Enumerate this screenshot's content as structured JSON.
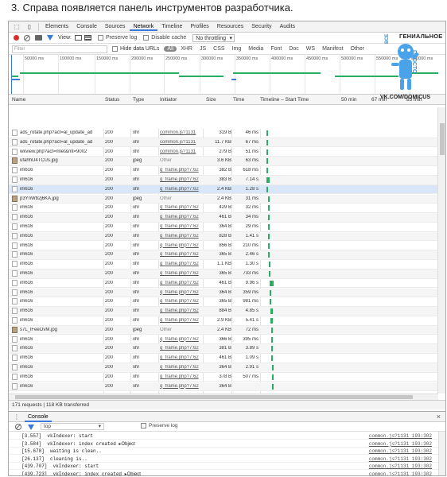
{
  "caption": "3. Справа появляется панель инструментов разработчика.",
  "devtools": {
    "tabs": [
      "Elements",
      "Console",
      "Sources",
      "Network",
      "Timeline",
      "Profiles",
      "Resources",
      "Security",
      "Audits"
    ],
    "active_tab": "Network"
  },
  "network_toolbar": {
    "view_label": "View:",
    "preserve_log": "Preserve log",
    "disable_cache": "Disable cache",
    "throttling": "No throttling"
  },
  "filter_bar": {
    "placeholder": "Filter",
    "hide_data_urls": "Hide data URLs",
    "types": [
      "All",
      "XHR",
      "JS",
      "CSS",
      "Img",
      "Media",
      "Font",
      "Doc",
      "WS",
      "Manifest",
      "Other"
    ]
  },
  "overview": {
    "ticks": [
      "50000 ms",
      "100000 ms",
      "150000 ms",
      "200000 ms",
      "250000 ms",
      "300000 ms",
      "350000 ms",
      "400000 ms",
      "450000 ms",
      "500000 ms",
      "550000 ms",
      "600000 ms"
    ]
  },
  "grid": {
    "columns": [
      "Name",
      "Status",
      "Type",
      "Initiator",
      "Size",
      "Time",
      "Timeline – Start Time",
      "50 min",
      "67 min",
      "83 min"
    ],
    "rows": [
      {
        "name": "ads_rotate.php?act=al_update_ad",
        "status": "200",
        "type": "xhr",
        "initiator": "common.js?1131",
        "size": "319 B",
        "time": "46 ms",
        "icon": "doc"
      },
      {
        "name": "ads_rotate.php?act=al_update_ad",
        "status": "200",
        "type": "xhr",
        "initiator": "common.js?1131",
        "size": "11.7 KB",
        "time": "67 ms",
        "icon": "doc"
      },
      {
        "name": "wkview.php?act=mlet&mt=9002",
        "status": "200",
        "type": "xhr",
        "initiator": "common.js?1131",
        "size": "279 B",
        "time": "51 ms",
        "icon": "doc"
      },
      {
        "name": "ufahhU4TCUs.jpg",
        "status": "200",
        "type": "jpeg",
        "initiator": "Other",
        "size": "3.6 KB",
        "time": "63 ms",
        "icon": "img"
      },
      {
        "name": "im616",
        "status": "200",
        "type": "xhr",
        "initiator": "q_frame.php?7:62",
        "size": "382 B",
        "time": "618 ms",
        "icon": "doc"
      },
      {
        "name": "im616",
        "status": "200",
        "type": "xhr",
        "initiator": "q_frame.php?7:62",
        "size": "383 B",
        "time": "7.14 s",
        "icon": "doc"
      },
      {
        "name": "im616",
        "status": "200",
        "type": "xhr",
        "initiator": "q_frame.php?7:62",
        "size": "2.4 KB",
        "time": "1.28 s",
        "icon": "doc"
      },
      {
        "name": "p3YnWb2j6KA.jpg",
        "status": "200",
        "type": "jpeg",
        "initiator": "Other",
        "size": "2.4 KB",
        "time": "31 ms",
        "icon": "img"
      },
      {
        "name": "im616",
        "status": "200",
        "type": "xhr",
        "initiator": "q_frame.php?7:62",
        "size": "429 B",
        "time": "32 ms",
        "icon": "doc"
      },
      {
        "name": "im616",
        "status": "200",
        "type": "xhr",
        "initiator": "q_frame.php?7:62",
        "size": "461 B",
        "time": "34 ms",
        "icon": "doc"
      },
      {
        "name": "im616",
        "status": "200",
        "type": "xhr",
        "initiator": "q_frame.php?7:62",
        "size": "364 B",
        "time": "29 ms",
        "icon": "doc"
      },
      {
        "name": "im616",
        "status": "200",
        "type": "xhr",
        "initiator": "q_frame.php?7:62",
        "size": "828 B",
        "time": "1.41 s",
        "icon": "doc"
      },
      {
        "name": "im616",
        "status": "200",
        "type": "xhr",
        "initiator": "q_frame.php?7:62",
        "size": "856 B",
        "time": "210 ms",
        "icon": "doc"
      },
      {
        "name": "im616",
        "status": "200",
        "type": "xhr",
        "initiator": "q_frame.php?7:62",
        "size": "365 B",
        "time": "2.46 s",
        "icon": "doc"
      },
      {
        "name": "im616",
        "status": "200",
        "type": "xhr",
        "initiator": "q_frame.php?7:62",
        "size": "1.1 KB",
        "time": "1.30 s",
        "icon": "doc"
      },
      {
        "name": "im616",
        "status": "200",
        "type": "xhr",
        "initiator": "q_frame.php?7:62",
        "size": "365 B",
        "time": "733 ms",
        "icon": "doc"
      },
      {
        "name": "im616",
        "status": "200",
        "type": "xhr",
        "initiator": "q_frame.php?7:62",
        "size": "461 B",
        "time": "9.96 s",
        "icon": "doc"
      },
      {
        "name": "im616",
        "status": "200",
        "type": "xhr",
        "initiator": "q_frame.php?7:62",
        "size": "364 B",
        "time": "359 ms",
        "icon": "doc"
      },
      {
        "name": "im616",
        "status": "200",
        "type": "xhr",
        "initiator": "q_frame.php?7:62",
        "size": "365 B",
        "time": "981 ms",
        "icon": "doc"
      },
      {
        "name": "im616",
        "status": "200",
        "type": "xhr",
        "initiator": "q_frame.php?7:62",
        "size": "884 B",
        "time": "4.85 s",
        "icon": "doc"
      },
      {
        "name": "im616",
        "status": "200",
        "type": "xhr",
        "initiator": "q_frame.php?7:62",
        "size": "2.9 KB",
        "time": "5.41 s",
        "icon": "doc"
      },
      {
        "name": "s7L_lFeeOvM.jpg",
        "status": "200",
        "type": "jpeg",
        "initiator": "Other",
        "size": "2.4 KB",
        "time": "72 ms",
        "icon": "img"
      },
      {
        "name": "im616",
        "status": "200",
        "type": "xhr",
        "initiator": "q_frame.php?7:62",
        "size": "366 B",
        "time": "395 ms",
        "icon": "doc"
      },
      {
        "name": "im616",
        "status": "200",
        "type": "xhr",
        "initiator": "q_frame.php?7:62",
        "size": "381 B",
        "time": "3.89 s",
        "icon": "doc"
      },
      {
        "name": "im616",
        "status": "200",
        "type": "xhr",
        "initiator": "q_frame.php?7:62",
        "size": "461 B",
        "time": "1.09 s",
        "icon": "doc"
      },
      {
        "name": "im616",
        "status": "200",
        "type": "xhr",
        "initiator": "q_frame.php?7:62",
        "size": "364 B",
        "time": "2.91 s",
        "icon": "doc"
      },
      {
        "name": "im616",
        "status": "200",
        "type": "xhr",
        "initiator": "q_frame.php?7:62",
        "size": "378 B",
        "time": "507 ms",
        "icon": "doc"
      },
      {
        "name": "im616",
        "status": "200",
        "type": "xhr",
        "initiator": "q_frame.php?7:62",
        "size": "364 B",
        "time": "",
        "icon": "doc"
      }
    ]
  },
  "summary": "171 requests  |  118 KB transferred",
  "console": {
    "tab": "Console",
    "context": "top",
    "preserve_log": "Preserve log",
    "lines": [
      {
        "text": "[3.557]  vkIndexer: start",
        "object": "",
        "source": "common.js?1131 193:302"
      },
      {
        "text": "[3.584]  vkIndexer: index created ",
        "object": "▸Object",
        "source": "common.js?1131 193:302"
      },
      {
        "text": "[15.678]  waiting is clean..",
        "object": "",
        "source": "common.js?1131 193:302"
      },
      {
        "text": "[26.137]  cleaning is..",
        "object": "",
        "source": "common.js?1131 193:302"
      },
      {
        "text": "[439.707]  vkIndexer: start",
        "object": "",
        "source": "common.js?1131 193:302"
      },
      {
        "text": "[439.723]  vkIndexer: index created ",
        "object": "▸Object",
        "source": "common.js?1131 193:302"
      }
    ]
  },
  "watermark": {
    "top": "ГЕНИАЛЬНОЕ",
    "left": "ВСЕ",
    "right": "ПРОСТО",
    "bottom": "VK.COM/DOMICUS"
  },
  "colors": {
    "accent": "#3879d9",
    "timing_green": "#27ae60",
    "record_red": "#d93025"
  }
}
